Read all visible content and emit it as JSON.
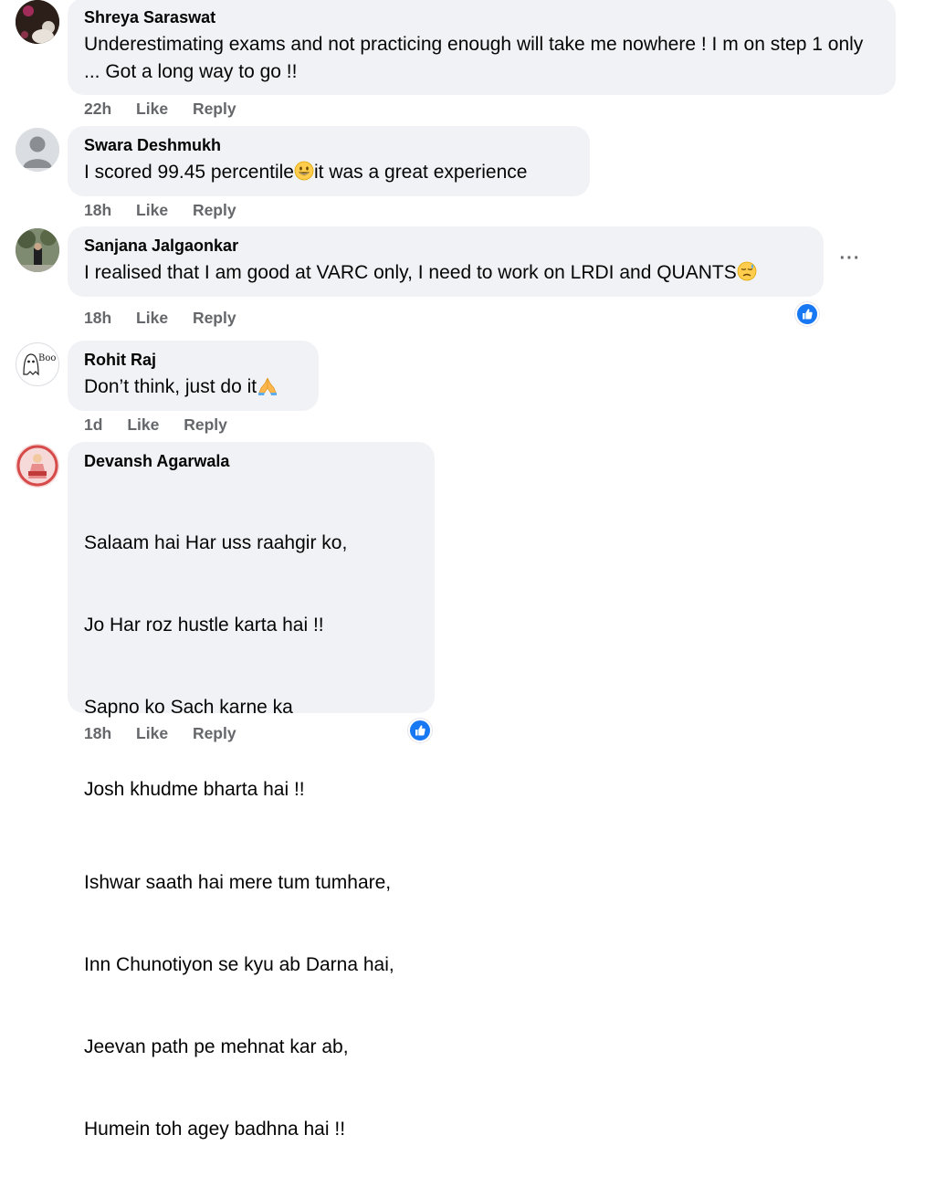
{
  "comments": [
    {
      "author": "Shreya Saraswat",
      "text": "Underestimating exams and not practicing enough will take me nowhere ! I m on step 1 only ... Got a long way to go !!",
      "time": "22h",
      "like": "Like",
      "reply": "Reply"
    },
    {
      "author": "Swara Deshmukh",
      "text_before": "I scored 99.45 percentile",
      "text_after": "it was a great experience",
      "time": "18h",
      "like": "Like",
      "reply": "Reply"
    },
    {
      "author": "Sanjana Jalgaonkar",
      "text": "I realised that I am good at VARC only, I need to work on LRDI and QUANTS",
      "time": "18h",
      "like": "Like",
      "reply": "Reply"
    },
    {
      "author": "Rohit Raj",
      "text": "Don’t think, just do it",
      "time": "1d",
      "like": "Like",
      "reply": "Reply",
      "avatar_text": "Boo"
    },
    {
      "author": "Devansh Agarwala",
      "lines_1": [
        "Salaam hai Har uss raahgir ko,",
        "Jo Har roz hustle karta hai !!",
        "Sapno ko Sach karne ka",
        "Josh khudme bharta hai !!"
      ],
      "lines_2": [
        "Ishwar saath hai mere tum tumhare,",
        "Inn Chunotiyon se kyu ab Darna hai,",
        "Jeevan path pe mehnat kar ab,",
        "Humein toh agey badhna hai !!"
      ],
      "time": "18h",
      "like": "Like",
      "reply": "Reply"
    }
  ],
  "icons": {
    "more": "more-options-icon",
    "like_reaction": "like-reaction-icon",
    "grinning": "grinning-face-emoji",
    "downcast": "downcast-sweat-emoji",
    "folded_hands": "folded-hands-emoji"
  },
  "colors": {
    "bubble": "#f0f2f5",
    "meta_text": "#65676b",
    "like_blue": "#1877f2"
  },
  "more_glyph": "···"
}
